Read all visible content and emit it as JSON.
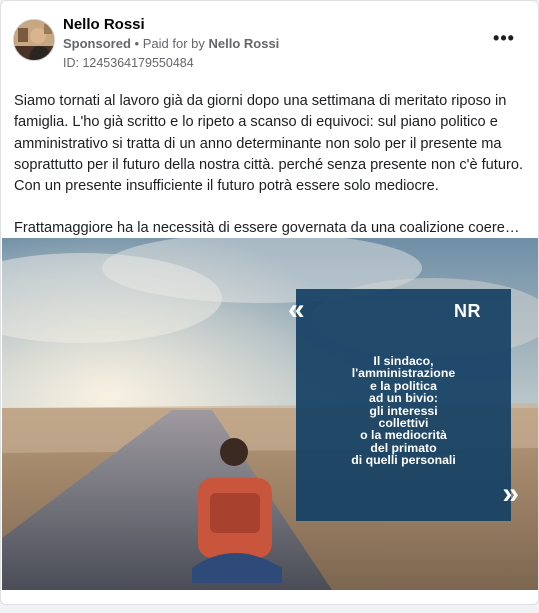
{
  "post": {
    "author_name": "Nello Rossi",
    "sponsored_label": "Sponsored",
    "separator": "•",
    "paid_for_prefix": "Paid for by",
    "paid_for_name": "Nello Rossi",
    "ad_id": "ID: 1245364179550484",
    "more_icon": "more-options-icon",
    "paragraph_1": "Siamo tornati al lavoro già da giorni dopo una settimana di meritato riposo in famiglia. L'ho già scritto e lo ripeto a scanso di equivoci: sul piano politico e amministrativo si tratta di un anno determinante non solo per il presente ma soprattutto per il futuro della nostra città. perché senza presente non c'è futuro. Con un presente insufficiente il futuro potrà essere solo mediocre.",
    "paragraph_2": "Frattamaggiore ha la necessità di essere governata da una coalizione coerente c..."
  },
  "ad_image": {
    "quote_open": "«",
    "quote_close": "»",
    "logo_text": "NR",
    "lines": [
      "Il sindaco,",
      "l'amministrazione",
      "e la politica",
      "ad un bivio:",
      "gli interessi",
      "collettivi",
      "o la mediocrità",
      "del primato",
      "di quelli personali"
    ],
    "overlay_color": "#164164"
  },
  "colors": {
    "text_primary": "#050505",
    "text_secondary": "#65676b"
  }
}
